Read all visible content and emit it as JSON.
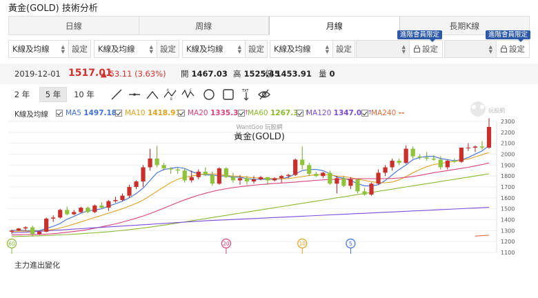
{
  "title": "黃金(GOLD) 技術分析",
  "tabs": [
    {
      "label": "日線",
      "active": false
    },
    {
      "label": "周線",
      "active": false
    },
    {
      "label": "月線",
      "active": true
    },
    {
      "label": "長期K線",
      "active": false
    }
  ],
  "selectors": [
    {
      "value": "K線及均線",
      "button": "設定",
      "locked": false
    },
    {
      "value": "K線及均線",
      "button": "設定",
      "locked": false
    },
    {
      "value": "K線及均線",
      "button": "設定",
      "locked": false
    },
    {
      "value": "K線及均線",
      "button": "設定",
      "locked": false
    },
    {
      "value": "",
      "button": "設定",
      "locked": true,
      "badge": "進階會員限定"
    },
    {
      "value": "",
      "button": "設定",
      "locked": true,
      "badge": "進階會員限定"
    }
  ],
  "quote": {
    "date": "2019-12-01",
    "price": "1517.01",
    "change": "▲ 53.11 (3.63%)",
    "open_label": "開",
    "open": "1467.03",
    "high_label": "高",
    "high": "1525.45",
    "low_label": "低",
    "low": "1453.91",
    "volume_label": "量",
    "volume": "0"
  },
  "ranges": [
    {
      "label": "2 年",
      "active": false
    },
    {
      "label": "5 年",
      "active": true
    },
    {
      "label": "10 年",
      "active": false
    }
  ],
  "tools": [
    "trend-line-icon",
    "horizontal-line-icon",
    "triangle-pattern-icon",
    "abcd-pattern-icon",
    "xabcd-pattern-icon",
    "circle-icon",
    "rectangle-icon",
    "text-annotation-icon",
    "hide-drawings-icon"
  ],
  "legend": {
    "label": "K線及均線",
    "items": [
      {
        "name": "MA5",
        "value": "1497.18",
        "arrow": "↑",
        "color": "#3b6fd6"
      },
      {
        "name": "MA10",
        "value": "1418.91",
        "arrow": "↑",
        "color": "#e0a020"
      },
      {
        "name": "MA20",
        "value": "1335.35",
        "arrow": "↑",
        "color": "#d8407a"
      },
      {
        "name": "MA60",
        "value": "1267.32",
        "arrow": "↑",
        "color": "#8ab830"
      },
      {
        "name": "MA120",
        "value": "1347.09",
        "arrow": "↑",
        "color": "#7a4ad8"
      },
      {
        "name": "MA240",
        "value": "--",
        "arrow": "",
        "color": "#e06a3a"
      }
    ]
  },
  "chart_data": {
    "type": "candlestick",
    "watermark": "WantGoo 玩股網",
    "title": "黃金(GOLD)",
    "logo_text": "玩股網",
    "ylim": [
      1100,
      2300
    ],
    "yticks": [
      1100,
      1200,
      1300,
      1400,
      1500,
      1600,
      1700,
      1800,
      1900,
      2000,
      2100,
      2200,
      2300
    ],
    "grid": true,
    "up_color": "#c9302c",
    "down_color": "#8fc43a",
    "candles": [
      [
        1290,
        1310,
        1270,
        1300
      ],
      [
        1300,
        1325,
        1295,
        1320
      ],
      [
        1320,
        1340,
        1300,
        1330
      ],
      [
        1330,
        1345,
        1250,
        1270
      ],
      [
        1270,
        1300,
        1260,
        1290
      ],
      [
        1290,
        1420,
        1285,
        1410
      ],
      [
        1410,
        1440,
        1380,
        1420
      ],
      [
        1420,
        1500,
        1410,
        1490
      ],
      [
        1490,
        1520,
        1440,
        1450
      ],
      [
        1450,
        1490,
        1440,
        1470
      ],
      [
        1470,
        1520,
        1460,
        1510
      ],
      [
        1510,
        1520,
        1460,
        1470
      ],
      [
        1470,
        1540,
        1460,
        1530
      ],
      [
        1530,
        1560,
        1500,
        1510
      ],
      [
        1510,
        1580,
        1480,
        1570
      ],
      [
        1570,
        1610,
        1555,
        1580
      ],
      [
        1580,
        1640,
        1570,
        1620
      ],
      [
        1620,
        1720,
        1600,
        1700
      ],
      [
        1700,
        1760,
        1680,
        1750
      ],
      [
        1750,
        1900,
        1700,
        1880
      ],
      [
        1880,
        2050,
        1850,
        1960
      ],
      [
        1960,
        2075,
        1880,
        1900
      ],
      [
        1900,
        1920,
        1850,
        1870
      ],
      [
        1870,
        1880,
        1820,
        1860
      ],
      [
        1860,
        1880,
        1820,
        1850
      ],
      [
        1850,
        1870,
        1740,
        1760
      ],
      [
        1760,
        1850,
        1740,
        1790
      ],
      [
        1790,
        1860,
        1770,
        1840
      ],
      [
        1840,
        1880,
        1800,
        1810
      ],
      [
        1810,
        1840,
        1710,
        1730
      ],
      [
        1730,
        1880,
        1720,
        1870
      ],
      [
        1870,
        1880,
        1780,
        1790
      ],
      [
        1790,
        1830,
        1740,
        1760
      ],
      [
        1760,
        1810,
        1720,
        1780
      ],
      [
        1780,
        1800,
        1720,
        1750
      ],
      [
        1750,
        1800,
        1730,
        1770
      ],
      [
        1770,
        1800,
        1760,
        1790
      ],
      [
        1790,
        1790,
        1720,
        1760
      ],
      [
        1760,
        1790,
        1750,
        1780
      ],
      [
        1780,
        1810,
        1740,
        1800
      ],
      [
        1800,
        1820,
        1780,
        1810
      ],
      [
        1810,
        1960,
        1800,
        1950
      ],
      [
        1950,
        2070,
        1860,
        1900
      ],
      [
        1900,
        1920,
        1800,
        1820
      ],
      [
        1820,
        1840,
        1790,
        1800
      ],
      [
        1800,
        1840,
        1780,
        1830
      ],
      [
        1830,
        1850,
        1720,
        1730
      ],
      [
        1730,
        1800,
        1640,
        1780
      ],
      [
        1780,
        1800,
        1700,
        1710
      ],
      [
        1710,
        1790,
        1680,
        1770
      ],
      [
        1770,
        1770,
        1640,
        1660
      ],
      [
        1660,
        1690,
        1620,
        1630
      ],
      [
        1630,
        1740,
        1620,
        1730
      ],
      [
        1730,
        1860,
        1720,
        1830
      ],
      [
        1830,
        1900,
        1800,
        1880
      ],
      [
        1880,
        1960,
        1850,
        1940
      ],
      [
        1940,
        1960,
        1900,
        1920
      ],
      [
        1920,
        2080,
        1910,
        2050
      ],
      [
        2050,
        2070,
        1960,
        1980
      ],
      [
        1980,
        2000,
        1950,
        1970
      ],
      [
        1970,
        2020,
        1940,
        1960
      ],
      [
        1960,
        1990,
        1940,
        1950
      ],
      [
        1950,
        1980,
        1860,
        1880
      ],
      [
        1880,
        1950,
        1860,
        1940
      ],
      [
        1940,
        1960,
        1920,
        1930
      ],
      [
        1930,
        2060,
        1920,
        2060
      ],
      [
        2060,
        2100,
        2030,
        2060
      ],
      [
        2060,
        2080,
        2020,
        2070
      ],
      [
        2070,
        2120,
        2040,
        2060
      ],
      [
        2060,
        2330,
        2050,
        2250
      ]
    ],
    "ma": {
      "MA5": [
        1300,
        1305,
        1300,
        1300,
        1300,
        1320,
        1340,
        1365,
        1405,
        1430,
        1460,
        1480,
        1490,
        1500,
        1525,
        1545,
        1570,
        1600,
        1640,
        1690,
        1760,
        1830,
        1860,
        1870,
        1880,
        1870,
        1840,
        1820,
        1810,
        1810,
        1800,
        1800,
        1790,
        1790,
        1775,
        1770,
        1770,
        1770,
        1770,
        1775,
        1790,
        1820,
        1850,
        1860,
        1860,
        1850,
        1820,
        1790,
        1780,
        1760,
        1730,
        1710,
        1710,
        1720,
        1760,
        1810,
        1860,
        1900,
        1950,
        1970,
        1980,
        1980,
        1960,
        1950,
        1940,
        1950,
        1970,
        2000,
        2030,
        2080
      ],
      "MA10": [
        1290,
        1295,
        1295,
        1295,
        1295,
        1305,
        1310,
        1325,
        1340,
        1360,
        1380,
        1400,
        1420,
        1440,
        1460,
        1480,
        1500,
        1525,
        1550,
        1580,
        1620,
        1660,
        1700,
        1740,
        1770,
        1790,
        1800,
        1810,
        1820,
        1820,
        1815,
        1805,
        1800,
        1795,
        1790,
        1785,
        1780,
        1778,
        1776,
        1775,
        1776,
        1785,
        1795,
        1805,
        1812,
        1815,
        1810,
        1800,
        1795,
        1785,
        1772,
        1760,
        1748,
        1740,
        1738,
        1745,
        1765,
        1795,
        1830,
        1860,
        1885,
        1905,
        1915,
        1925,
        1935,
        1945,
        1955,
        1975,
        1995,
        2015
      ],
      "MA20": [
        1260,
        1262,
        1264,
        1265,
        1266,
        1268,
        1272,
        1278,
        1285,
        1292,
        1300,
        1310,
        1322,
        1335,
        1348,
        1362,
        1378,
        1396,
        1414,
        1434,
        1456,
        1480,
        1506,
        1532,
        1558,
        1582,
        1604,
        1624,
        1642,
        1658,
        1672,
        1684,
        1694,
        1702,
        1710,
        1716,
        1722,
        1727,
        1732,
        1736,
        1740,
        1745,
        1750,
        1755,
        1760,
        1765,
        1768,
        1770,
        1772,
        1774,
        1775,
        1776,
        1776,
        1776,
        1776,
        1778,
        1782,
        1788,
        1796,
        1806,
        1818,
        1830,
        1840,
        1850,
        1860,
        1870,
        1880,
        1892,
        1905,
        1920
      ],
      "MA60": [
        1245,
        1247,
        1249,
        1251,
        1253,
        1255,
        1258,
        1261,
        1264,
        1268,
        1272,
        1276,
        1280,
        1285,
        1290,
        1296,
        1302,
        1309,
        1316,
        1324,
        1332,
        1341,
        1350,
        1360,
        1370,
        1380,
        1390,
        1400,
        1410,
        1420,
        1430,
        1440,
        1450,
        1460,
        1470,
        1480,
        1490,
        1500,
        1510,
        1520,
        1530,
        1540,
        1550,
        1560,
        1570,
        1580,
        1590,
        1600,
        1610,
        1620,
        1630,
        1640,
        1650,
        1660,
        1670,
        1680,
        1690,
        1700,
        1710,
        1720,
        1730,
        1740,
        1750,
        1760,
        1770,
        1780,
        1790,
        1800,
        1810,
        1820
      ],
      "MA120": [
        1280,
        1283,
        1286,
        1290,
        1294,
        1298,
        1302,
        1306,
        1310,
        1314,
        1318,
        1322,
        1326,
        1330,
        1334,
        1338,
        1342,
        1346,
        1350,
        1354,
        1358,
        1362,
        1366,
        1370,
        1374,
        1378,
        1382,
        1386,
        1390,
        1393,
        1396,
        1399,
        1402,
        1405,
        1408,
        1411,
        1414,
        1417,
        1420,
        1423,
        1426,
        1429,
        1432,
        1435,
        1438,
        1441,
        1444,
        1447,
        1450,
        1453,
        1456,
        1459,
        1462,
        1465,
        1468,
        1471,
        1474,
        1477,
        1480,
        1483,
        1486,
        1489,
        1492,
        1495,
        1498,
        1501,
        1504,
        1507,
        1510,
        1513
      ],
      "MA240": [
        null,
        null,
        null,
        null,
        null,
        null,
        null,
        null,
        null,
        null,
        null,
        null,
        null,
        null,
        null,
        null,
        null,
        null,
        null,
        null,
        null,
        null,
        null,
        null,
        null,
        null,
        null,
        null,
        null,
        null,
        null,
        null,
        null,
        null,
        null,
        null,
        null,
        null,
        null,
        null,
        null,
        null,
        null,
        null,
        null,
        null,
        null,
        null,
        null,
        null,
        null,
        null,
        null,
        null,
        null,
        null,
        null,
        null,
        null,
        null,
        null,
        null,
        null,
        null,
        null,
        null,
        null,
        1250,
        1254,
        1258
      ]
    },
    "period_markers": [
      {
        "label": "60",
        "index": 0,
        "color": "#8ab830"
      },
      {
        "label": "20",
        "index": 31,
        "color": "#d8407a"
      },
      {
        "label": "10",
        "index": 42,
        "color": "#e0a020"
      },
      {
        "label": "5",
        "index": 49,
        "color": "#3b6fd6"
      }
    ]
  },
  "footer": "主力進出變化"
}
